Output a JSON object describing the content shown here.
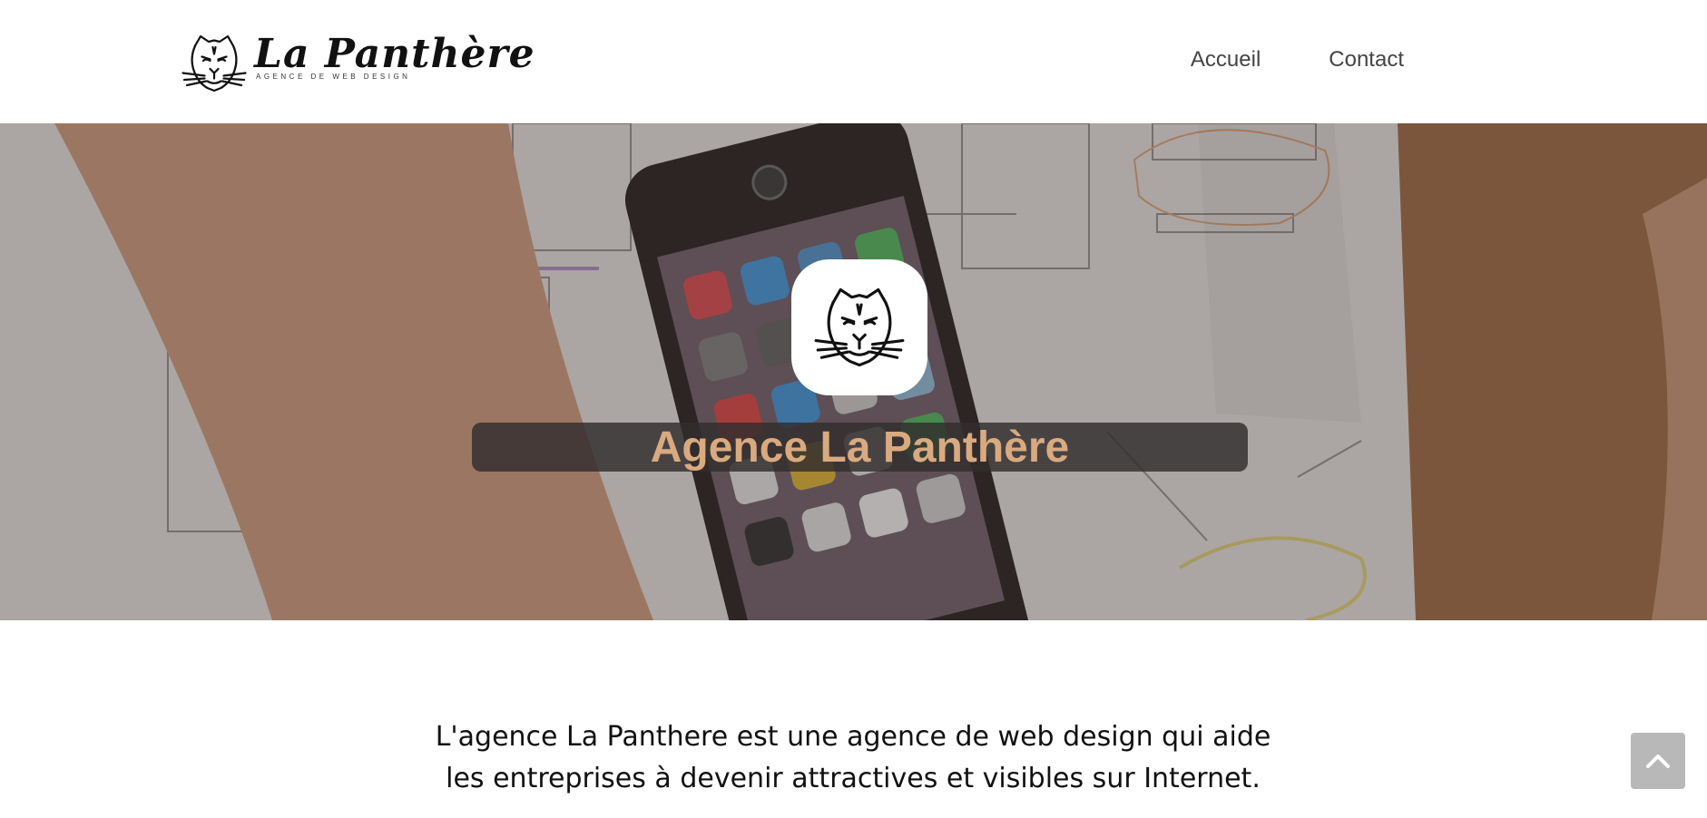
{
  "header": {
    "logo": {
      "name": "La Panthère",
      "tagline": "AGENCE DE WEB DESIGN",
      "icon": "panther-head-icon"
    },
    "nav": [
      {
        "label": "Accueil"
      },
      {
        "label": "Contact"
      }
    ]
  },
  "hero": {
    "title": "Agence La Panthère",
    "logo_icon": "panther-head-icon",
    "title_color": "#d9aa80"
  },
  "intro": {
    "line1": "L'agence La Panthere est une agence de web design qui aide",
    "line2": "les entreprises à devenir attractives et visibles sur Internet."
  },
  "back_to_top": {
    "icon": "chevron-up-icon"
  }
}
